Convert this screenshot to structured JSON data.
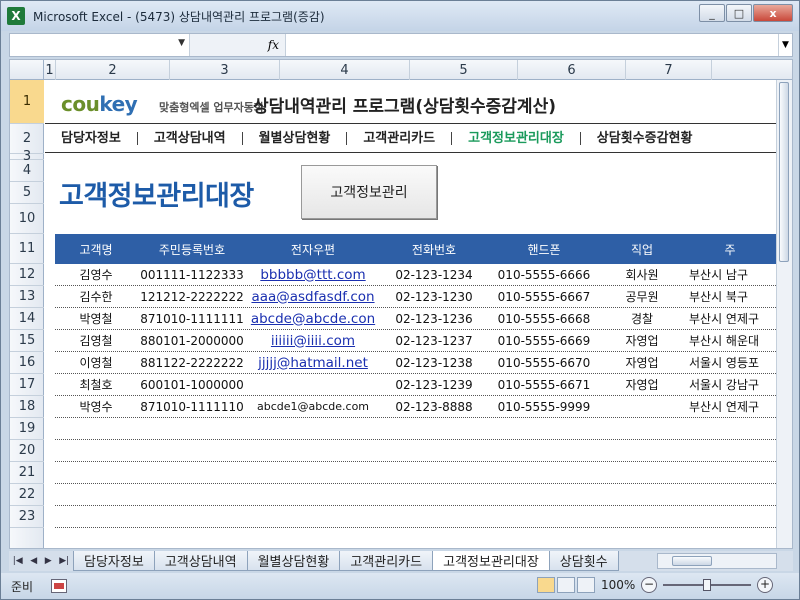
{
  "window": {
    "app_logo": "X",
    "title": "Microsoft Excel - (5473) 상담내역관리 프로그램(증감)",
    "minimize": "_",
    "restore": "□",
    "close": "x"
  },
  "formula": {
    "fx": "fx"
  },
  "columns": [
    "1",
    "2",
    "3",
    "4",
    "5",
    "6",
    "7"
  ],
  "rows": [
    "1",
    "2",
    "3",
    "4",
    "5",
    "10",
    "11",
    "12",
    "13",
    "14",
    "15",
    "16",
    "17",
    "18",
    "19",
    "20",
    "21",
    "22",
    "23"
  ],
  "banner": {
    "brand_a": "cou",
    "brand_b": "key",
    "brand_sub": "맞춤형엑셀 업무자동화",
    "title": "상담내역관리 프로그램(상담횟수증감계산)"
  },
  "menu": [
    "담당자정보",
    "고객상담내역",
    "월별상담현황",
    "고객관리카드",
    "고객정보관리대장",
    "상담횟수증감현황"
  ],
  "menu_active_index": 4,
  "sheet_title": "고객정보관리대장",
  "mgmt_button": "고객정보관리",
  "table": {
    "headers": [
      "고객명",
      "주민등록번호",
      "전자우편",
      "전화번호",
      "핸드폰",
      "직업",
      "주"
    ],
    "rows": [
      {
        "name": "김영수",
        "id": "001111-1122333",
        "email": "bbbbb@ttt.com",
        "tel": "02-123-1234",
        "mobile": "010-5555-6666",
        "job": "회사원",
        "addr": "부산시 남구"
      },
      {
        "name": "김수한",
        "id": "121212-2222222",
        "email": "aaa@asdfasdf.con",
        "tel": "02-123-1230",
        "mobile": "010-5555-6667",
        "job": "공무원",
        "addr": "부산시 북구"
      },
      {
        "name": "박영철",
        "id": "871010-1111111",
        "email": "abcde@abcde.con",
        "tel": "02-123-1236",
        "mobile": "010-5555-6668",
        "job": "경찰",
        "addr": "부산시 연제구"
      },
      {
        "name": "김영철",
        "id": "880101-2000000",
        "email": "iiiiii@iiii.com",
        "tel": "02-123-1237",
        "mobile": "010-5555-6669",
        "job": "자영업",
        "addr": "부산시 해운대"
      },
      {
        "name": "이영철",
        "id": "881122-2222222",
        "email": "jjjjj@hatmail.net",
        "tel": "02-123-1238",
        "mobile": "010-5555-6670",
        "job": "자영업",
        "addr": "서울시 영등포"
      },
      {
        "name": "최철호",
        "id": "600101-1000000",
        "email": "",
        "tel": "02-123-1239",
        "mobile": "010-5555-6671",
        "job": "자영업",
        "addr": "서울시 강남구"
      },
      {
        "name": "박영수",
        "id": "871010-1111110",
        "email": "abcde1@abcde.com",
        "tel": "02-123-8888",
        "mobile": "010-5555-9999",
        "job": "",
        "addr": "부산시 연제구"
      }
    ]
  },
  "sheet_tabs": [
    "담당자정보",
    "고객상담내역",
    "월별상담현황",
    "고객관리카드",
    "고객정보관리대장",
    "상담횟수"
  ],
  "active_tab_index": 4,
  "status": {
    "ready": "준비",
    "zoom": "100%",
    "zoom_minus": "−",
    "zoom_plus": "+"
  },
  "colors": {
    "header_blue": "#2e5fa6",
    "title_blue": "#1d5ba8",
    "active_menu": "#1a9a5b"
  }
}
